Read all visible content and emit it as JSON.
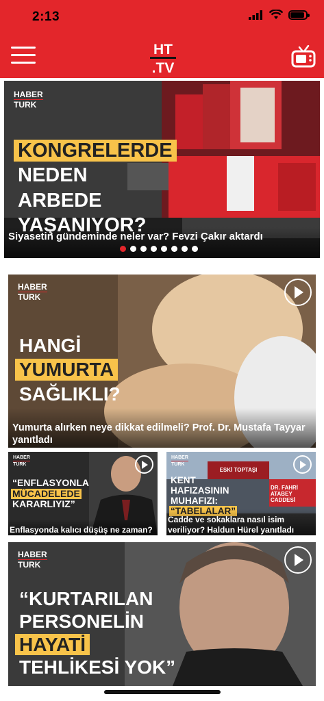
{
  "status_bar": {
    "time": "2:13",
    "battery_level": 0.9
  },
  "app_bar": {
    "logo_line1": "HT",
    "logo_line2": ".TV"
  },
  "colors": {
    "brand_red": "#e3262b",
    "highlight_yellow": "#f8c34a"
  },
  "hero": {
    "brand_line1": "HABER",
    "brand_line2": "TURK",
    "headline_lines": [
      "KONGRELERDE",
      "NEDEN",
      "ARBEDE",
      "YAŞANIYOR?"
    ],
    "caption": "Siyasetin gündeminde neler var? Fevzi Çakır aktardı",
    "carousel_pages": 8,
    "carousel_active_index": 0
  },
  "videos": [
    {
      "brand_line1": "HABER",
      "brand_line2": "TURK",
      "headline_lines": [
        "HANGİ",
        "YUMURTA",
        "SAĞLIKLI?"
      ],
      "caption": "Yumurta alırken neye dikkat edilmeli? Prof. Dr. Mustafa Tayyar yanıtladı"
    },
    {
      "brand_line1": "HABER",
      "brand_line2": "TURK",
      "headline_lines": [
        "“ENFLASYONLA",
        "MÜCADELEDE",
        "KARARLIYIZ”"
      ],
      "caption": "Enflasyonda kalıcı düşüş ne zaman?"
    },
    {
      "brand_line1": "HABER",
      "brand_line2": "TURK",
      "headline_lines": [
        "KENT",
        "HAFIZASININ",
        "MUHAFIZI:",
        "“TABELALAR”"
      ],
      "sign_text_1": "ESKİ TOPTAŞI",
      "sign_text_2": "DR. FAHRİ ATABEY CADDESİ",
      "caption": "Cadde ve sokaklara nasıl isim veriliyor? Haldun Hürel yanıtladı"
    },
    {
      "brand_line1": "HABER",
      "brand_line2": "TURK",
      "headline_lines": [
        "“KURTARILAN",
        "PERSONELİN",
        "HAYATİ",
        "TEHLİKESİ YOK”"
      ]
    }
  ]
}
